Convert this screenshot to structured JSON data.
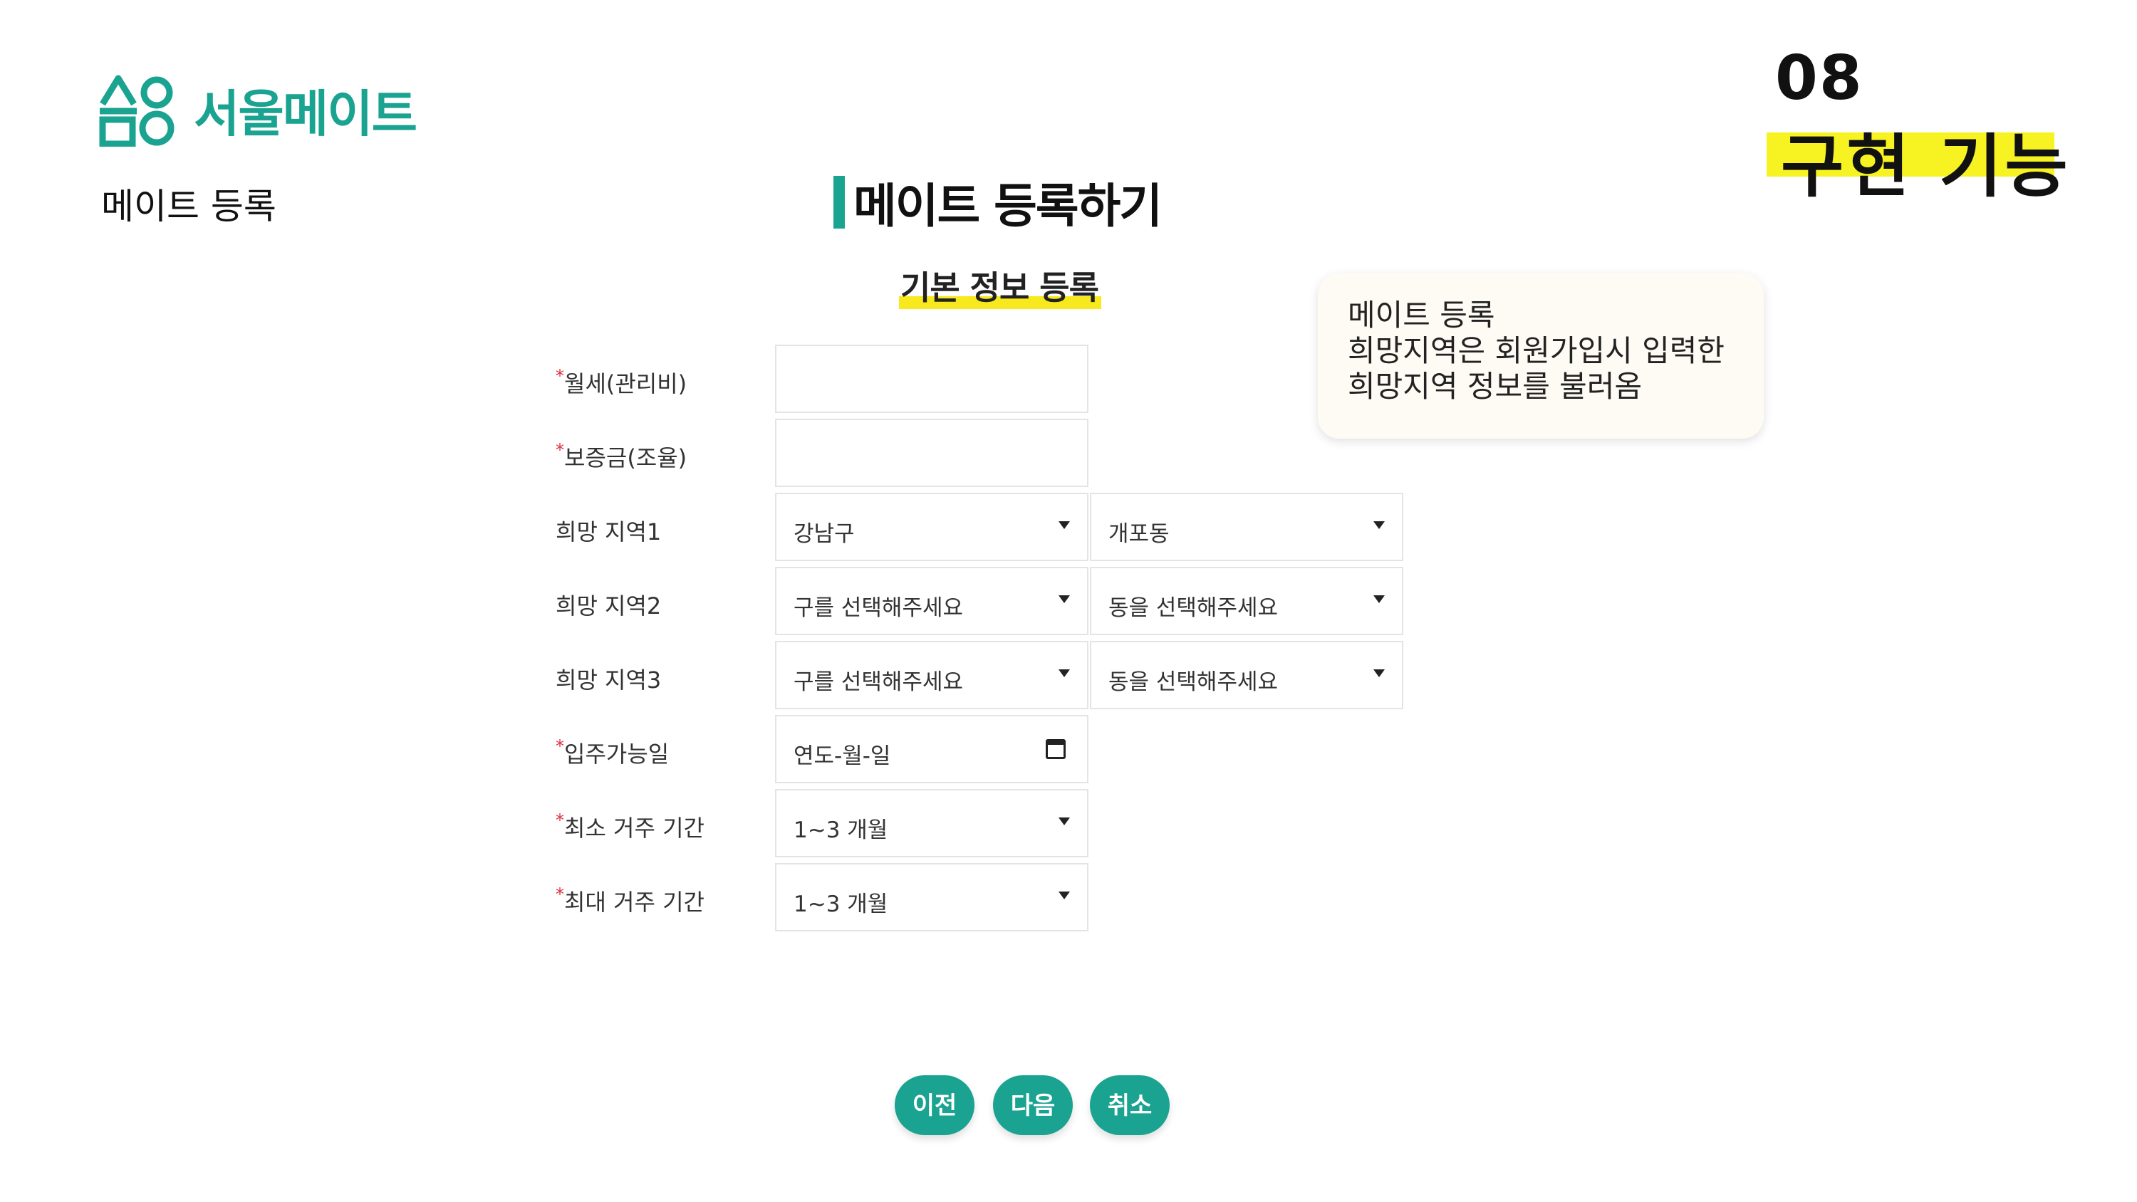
{
  "brand": {
    "name": "서울메이트",
    "color": "#1aa391",
    "icon": "seoulmate-logo-icon"
  },
  "section": {
    "title": "메이트 등록"
  },
  "chapter": {
    "number": "08",
    "title": "구현 기능",
    "highlight_color": "#f7f222"
  },
  "form": {
    "heading": "메이트 등록하기",
    "subheading": "기본 정보 등록",
    "rows": [
      {
        "required": true,
        "label": "월세(관리비)",
        "value1": "",
        "value2": null
      },
      {
        "required": true,
        "label": "보증금(조율)",
        "value1": "",
        "value2": null
      },
      {
        "required": false,
        "label": "희망 지역1",
        "value1": "강남구",
        "value2": "개포동"
      },
      {
        "required": false,
        "label": "희망 지역2",
        "value1": "구를 선택해주세요",
        "value2": "동을 선택해주세요"
      },
      {
        "required": false,
        "label": "희망 지역3",
        "value1": "구를 선택해주세요",
        "value2": "동을 선택해주세요"
      },
      {
        "required": true,
        "label": "입주가능일",
        "value1": "연도-월-일",
        "value2": null
      },
      {
        "required": true,
        "label": "최소 거주 기간",
        "value1": "1~3 개월",
        "value2": null
      },
      {
        "required": true,
        "label": "최대 거주 기간",
        "value1": "1~3 개월",
        "value2": null
      }
    ],
    "required_mark": "*"
  },
  "buttons": {
    "prev": "이전",
    "next": "다음",
    "cancel": "취소"
  },
  "callout": {
    "line1": "메이트 등록",
    "line2": "희망지역은 회원가입시 입력한",
    "line3": "희망지역 정보를 불러옴"
  }
}
